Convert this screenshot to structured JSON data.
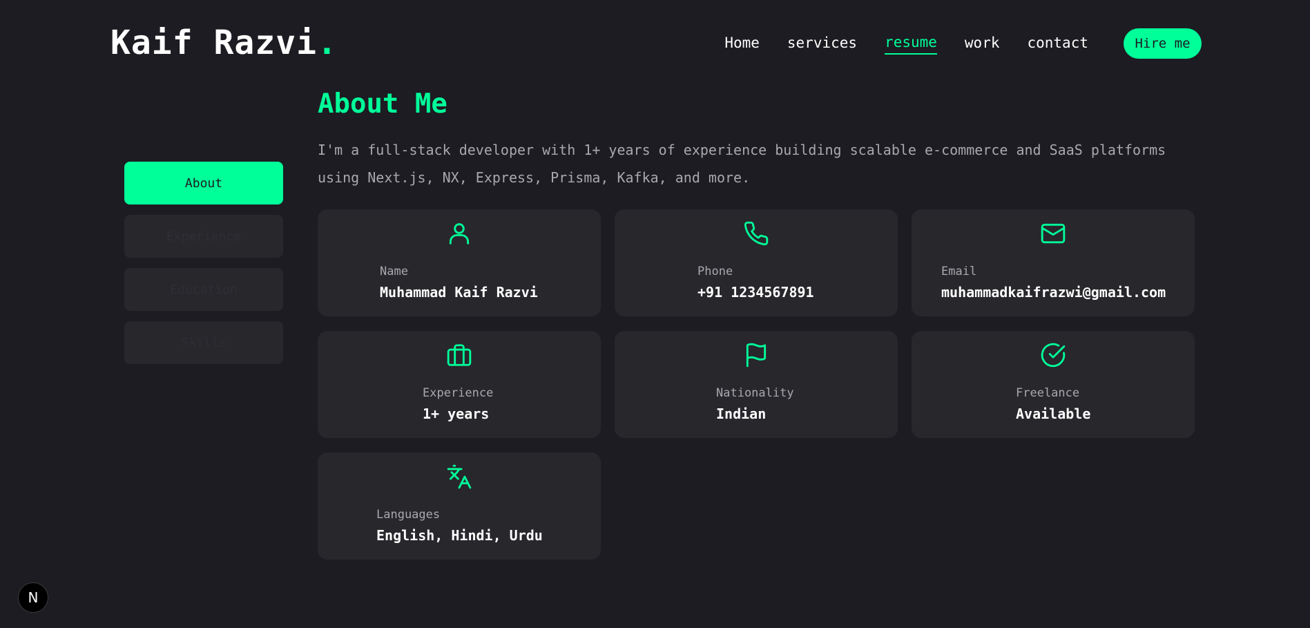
{
  "header": {
    "logo_text": "Kaif Razvi",
    "logo_dot": ".",
    "nav": [
      {
        "label": "Home"
      },
      {
        "label": "services"
      },
      {
        "label": "resume"
      },
      {
        "label": "work"
      },
      {
        "label": "contact"
      }
    ],
    "hire_label": "Hire me"
  },
  "tabs": [
    {
      "label": "About"
    },
    {
      "label": "Experience"
    },
    {
      "label": "Education"
    },
    {
      "label": "Skills"
    }
  ],
  "about": {
    "title": "About Me",
    "description": "I'm a full-stack developer with 1+ years of experience building scalable e-commerce and SaaS platforms using Next.js, NX, Express, Prisma, Kafka, and more."
  },
  "cards": [
    {
      "icon": "user-icon",
      "label": "Name",
      "value": "Muhammad Kaif Razvi"
    },
    {
      "icon": "phone-icon",
      "label": "Phone",
      "value": "+91 1234567891"
    },
    {
      "icon": "mail-icon",
      "label": "Email",
      "value": "muhammadkaifrazwi@gmail.com"
    },
    {
      "icon": "briefcase-icon",
      "label": "Experience",
      "value": "1+ years"
    },
    {
      "icon": "flag-icon",
      "label": "Nationality",
      "value": "Indian"
    },
    {
      "icon": "check-circle-icon",
      "label": "Freelance",
      "value": "Available"
    },
    {
      "icon": "languages-icon",
      "label": "Languages",
      "value": "English, Hindi, Urdu"
    }
  ],
  "badge_text": "N",
  "colors": {
    "accent": "#00ff99",
    "background": "#1c1c22",
    "card": "#27272c"
  }
}
